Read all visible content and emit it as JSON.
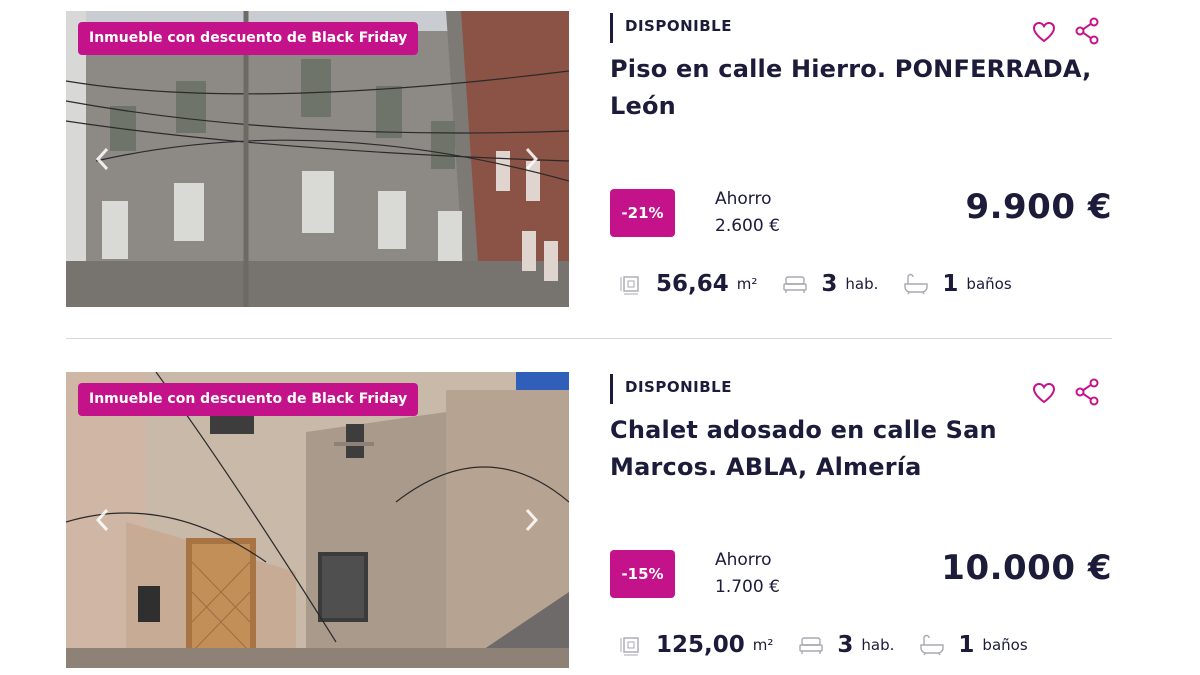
{
  "listings": [
    {
      "badge": "Inmueble con descuento de Black Friday",
      "status": "DISPONIBLE",
      "title": "Piso en calle Hierro. PONFERRADA, León",
      "discount": "-21%",
      "saving_label": "Ahorro",
      "saving_value": "2.600 €",
      "price": "9.900 €",
      "area": "56,64",
      "area_unit": "m²",
      "rooms": "3",
      "rooms_unit": "hab.",
      "baths": "1",
      "baths_unit": "baños"
    },
    {
      "badge": "Inmueble con descuento de Black Friday",
      "status": "DISPONIBLE",
      "title": "Chalet adosado en calle San Marcos. ABLA, Almería",
      "discount": "-15%",
      "saving_label": "Ahorro",
      "saving_value": "1.700 €",
      "price": "10.000 €",
      "area": "125,00",
      "area_unit": "m²",
      "rooms": "3",
      "rooms_unit": "hab.",
      "baths": "1",
      "baths_unit": "baños"
    }
  ],
  "colors": {
    "accent": "#c4138a",
    "text": "#1c1b3a",
    "divider": "#d6d6dc"
  },
  "icons": [
    "heart-icon",
    "share-icon",
    "chevron-left-icon",
    "chevron-right-icon",
    "area-icon",
    "bed-icon",
    "bath-icon"
  ]
}
